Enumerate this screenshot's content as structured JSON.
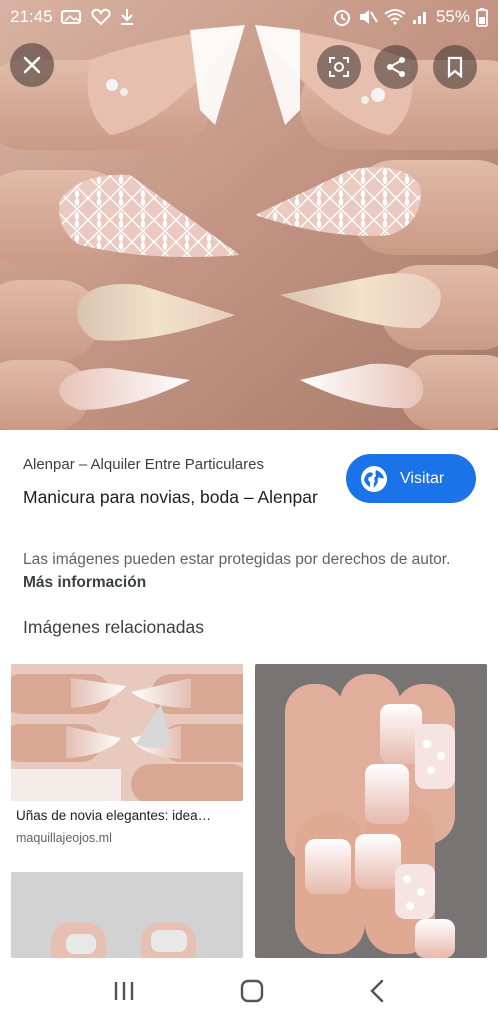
{
  "status_bar": {
    "time": "21:45",
    "battery": "55%"
  },
  "overlay": {
    "close_icon": "close-icon",
    "lens_icon": "lens-icon",
    "share_icon": "share-icon",
    "bookmark_icon": "bookmark-icon"
  },
  "result": {
    "source": "Alenpar – Alquiler Entre Particulares",
    "title": "Manicura para novias, boda – Alenpar",
    "visit_label": "Visitar",
    "notice_text": "Las imágenes pueden estar protegidas por derechos de autor.",
    "notice_link": "Más información"
  },
  "related": {
    "heading": "Imágenes relacionadas",
    "items": [
      {
        "caption": "Uñas de novia elegantes: idea…",
        "source": "maquillajeojos.ml"
      }
    ]
  },
  "colors": {
    "accent": "#1a73e8"
  }
}
